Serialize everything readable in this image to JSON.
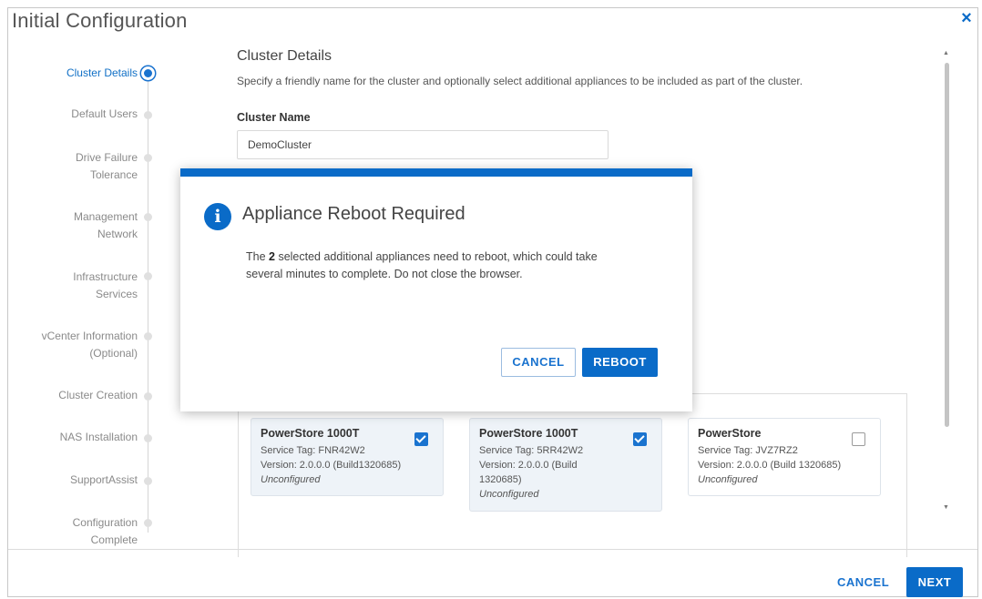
{
  "window": {
    "title": "Initial Configuration",
    "close_symbol": "×"
  },
  "stepper": {
    "steps": [
      {
        "label": "Cluster Details",
        "state": "active"
      },
      {
        "label": "Default Users",
        "state": "pending"
      },
      {
        "label_line1": "Drive Failure",
        "label_line2": "Tolerance",
        "state": "pending"
      },
      {
        "label_line1": "Management",
        "label_line2": "Network",
        "state": "pending"
      },
      {
        "label_line1": "Infrastructure",
        "label_line2": "Services",
        "state": "pending"
      },
      {
        "label_line1": "vCenter Information",
        "label_line2": "(Optional)",
        "state": "pending"
      },
      {
        "label": "Cluster Creation",
        "state": "pending"
      },
      {
        "label": "NAS Installation",
        "state": "pending"
      },
      {
        "label": "SupportAssist",
        "state": "pending"
      },
      {
        "label_line1": "Configuration",
        "label_line2": "Complete",
        "state": "pending"
      }
    ]
  },
  "content": {
    "title": "Cluster Details",
    "description": "Specify a friendly name for the cluster and optionally select additional appliances to be included as part of the cluster.",
    "cluster_name_label": "Cluster Name",
    "cluster_name_value": "DemoCluster"
  },
  "appliances": [
    {
      "name": "PowerStore 1000T",
      "service_tag": "Service Tag: FNR42W2",
      "version_line1": "Version: 2.0.0.0 (Build1320685)",
      "version_line2": "",
      "status": "Unconfigured",
      "checked": true
    },
    {
      "name": "PowerStore 1000T",
      "service_tag": "Service Tag: 5RR42W2",
      "version_line1": "Version: 2.0.0.0 (Build",
      "version_line2": "1320685)",
      "status": "Unconfigured",
      "checked": true
    },
    {
      "name": "PowerStore",
      "service_tag": "Service Tag: JVZ7RZ2",
      "version_line1": "Version: 2.0.0.0 (Build 1320685)",
      "version_line2": "",
      "status": "Unconfigured",
      "checked": false
    }
  ],
  "footer": {
    "cancel_label": "CANCEL",
    "next_label": "NEXT"
  },
  "modal": {
    "icon_glyph": "i",
    "title": "Appliance Reboot Required",
    "message_prefix": "The ",
    "message_count": "2",
    "message_line1_rest": " selected additional appliances need to reboot, which could take",
    "message_line2": "several minutes to complete. Do not close the browser.",
    "cancel_label": "CANCEL",
    "reboot_label": "REBOOT"
  },
  "colors": {
    "accent": "#0a6bc8",
    "active_step": "#1170c6",
    "card_selected_bg": "#eef3f8"
  }
}
